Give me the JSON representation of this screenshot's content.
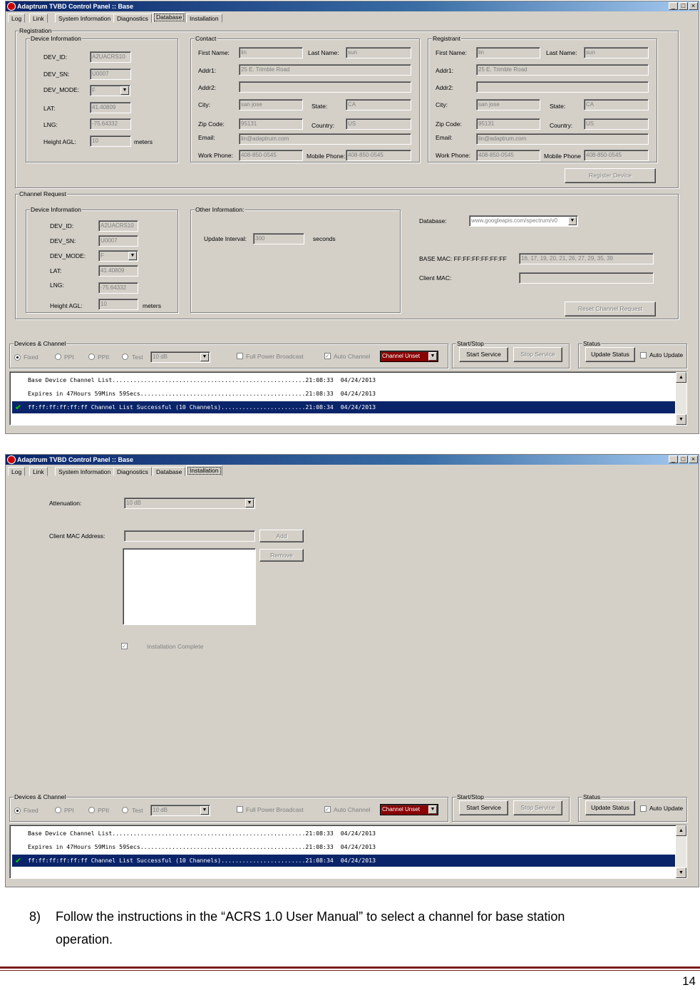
{
  "window_title": "Adaptrum TVBD Control Panel :: Base",
  "titlebar_buttons": {
    "min": "_",
    "max": "□",
    "close": "×"
  },
  "tabs": [
    "Log",
    "Link",
    "System Information",
    "Diagnostics",
    "Database",
    "Installation"
  ],
  "db": {
    "registration_legend": "Registration",
    "device_info_legend": "Device Information",
    "dev_id_label": "DEV_ID:",
    "dev_id": "A2UACRS10",
    "dev_sn_label": "DEV_SN:",
    "dev_sn": "U0007",
    "dev_mode_label": "DEV_MODE:",
    "dev_mode": "F",
    "lat_label": "LAT:",
    "lat": "41.40809",
    "lng_label": "LNG:",
    "lng": "-75.64332",
    "height_label": "Height AGL:",
    "height": "10",
    "height_unit": "meters",
    "contact_legend": "Contact",
    "first_name_label": "First Name:",
    "first_name": "lin",
    "last_name_label": "Last Name:",
    "last_name": "sun",
    "addr1_label": "Addr1:",
    "addr1": "25 E. Trimble Road",
    "addr2_label": "Addr2:",
    "addr2": "",
    "city_label": "City:",
    "city": "san jose",
    "state_label": "State:",
    "state": "CA",
    "zip_label": "Zip Code:",
    "zip": "95131",
    "country_label": "Country:",
    "country": "US",
    "email_label": "Email:",
    "email": "lin@adaptrum.com",
    "work_phone_label": "Work Phone:",
    "work_phone": "408-850-0545",
    "mobile_phone_label": "Mobile Phone:",
    "mobile_phone": "408-850-0545",
    "registrant_legend": "Registrant",
    "reg_mobile_phone_label": "Mobile Phone",
    "register_button": "Register Device",
    "channel_request_legend": "Channel Request",
    "cr_dev_id_label": "DEV_ID:",
    "cr_height_label": "Height AGL:",
    "other_info_legend": "Other Information:",
    "update_interval_label": "Update Interval:",
    "update_interval": "300",
    "update_interval_unit": "seconds",
    "database_label": "Database:",
    "database": "www.googleapis.com/spectrum/v0",
    "base_mac_label": "BASE MAC: FF:FF:FF:FF:FF:FF",
    "base_mac": "16, 17, 19, 20, 21, 26, 27, 29, 35, 39",
    "client_mac_label": "Client MAC:",
    "client_mac": "",
    "reset_button": "Reset Channel Request"
  },
  "bottom": {
    "dc_legend": "Devices & Channel",
    "modes": [
      "Fixed",
      "PPI",
      "PPII",
      "Test"
    ],
    "atten_value": "10 dB",
    "full_power": "Full Power Broadcast",
    "auto_channel": "Auto Channel",
    "channel_value": "Channel Unset",
    "start_stop_legend": "Start/Stop",
    "start_button": "Start Service",
    "stop_button": "Stop Service",
    "status_legend": "Status",
    "update_status_button": "Update Status",
    "auto_update": "Auto Update",
    "scroll_up": "▲",
    "scroll_down": "▼"
  },
  "log1": [
    "Base Device Channel List.......................................................21:08:33  04/24/2013",
    "Expires in 47Hours 59Mins 59Secs...............................................21:08:33  04/24/2013",
    "ff:ff:ff:ff:ff:ff Channel List Successful (10 Channels)........................21:08:34  04/24/2013"
  ],
  "log2": [
    "Base Device Channel List.......................................................21:08:33  04/24/2013",
    "Expires in 47Hours 59Mins 59Secs...............................................21:08:33  04/24/2013",
    "ff:ff:ff:ff:ff:ff Channel List Successful (10 Channels)........................21:08:34  04/24/2013"
  ],
  "inst": {
    "attenuation_label": "Attenuation:",
    "attenuation": "10 dB",
    "client_mac_label": "Client MAC Address:",
    "add_button": "Add",
    "remove_button": "Remove",
    "installation_complete": "Installation Complete"
  },
  "doc": {
    "step_number": "8)",
    "step_text": "Follow the instructions in the “ACRS 1.0 User Manual” to select a channel for base station",
    "step_text_2": "operation.",
    "page_number": "14",
    "rule_color": "#7b1c1c"
  },
  "colors": {
    "selection": "#0a246a",
    "title_start": "#0a246a",
    "check_green": "#00cc00"
  }
}
